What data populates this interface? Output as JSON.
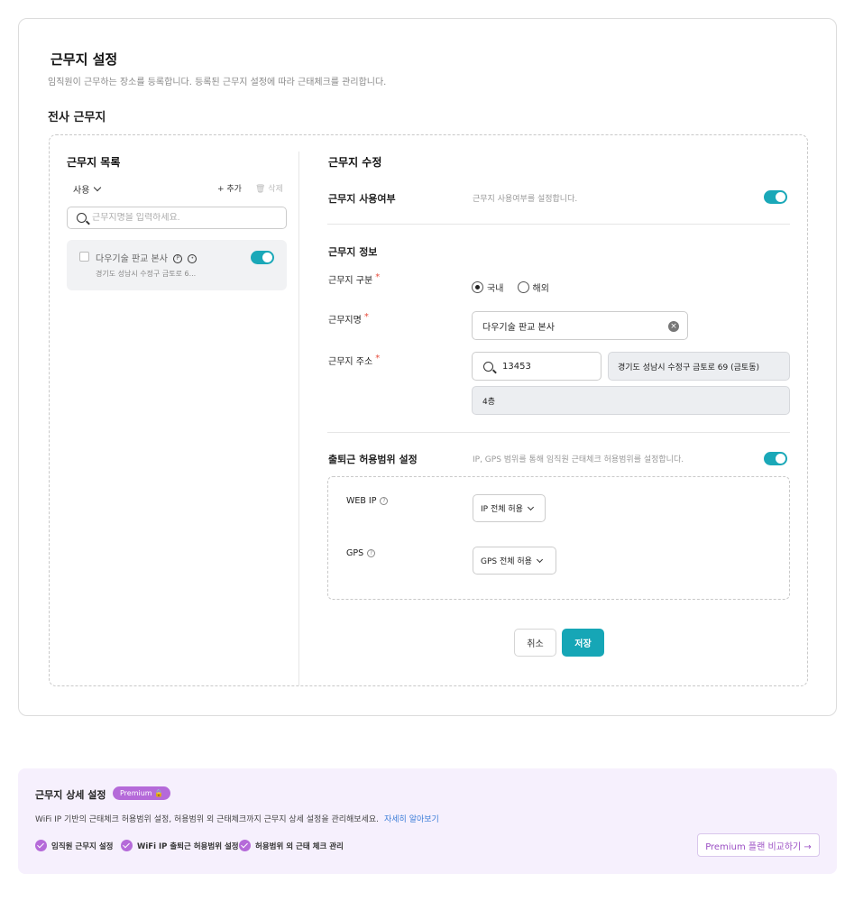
{
  "page": {
    "title": "근무지 설정",
    "subtitle": "임직원이 근무하는 장소를 등록합니다. 등록된 근무지 설정에 따라 근태체크를 관리합니다.",
    "section_title": "전사 근무지"
  },
  "list": {
    "title": "근무지 목록",
    "filter_label": "사용",
    "add_label": "+ 추가",
    "delete_label": "🗑 삭제",
    "search_placeholder": "근무지명을 입력하세요.",
    "items": [
      {
        "name": "다우기술 판교 본사",
        "address": "경기도 성남시 수정구 금토로 6...",
        "enabled": true
      }
    ]
  },
  "edit": {
    "title": "근무지 수정",
    "usage_label": "근무지 사용여부",
    "usage_hint": "근무지 사용여부를 설정합니다.",
    "usage_enabled": true,
    "info_title": "근무지 정보",
    "type_label": "근무지 구분",
    "type_options": [
      "국내",
      "해외"
    ],
    "type_selected": "국내",
    "name_label": "근무지명",
    "name_value": "다우기술 판교 본사",
    "address_label": "근무지 주소",
    "zip_value": "13453",
    "address_value": "경기도 성남시 수정구 금토로 69 (금토동)",
    "address_detail": "4층",
    "range_label": "출퇴근 허용범위 설정",
    "range_hint": "IP, GPS 범위를 통해 임직원 근태체크 허용범위를 설정합니다.",
    "range_enabled": true,
    "web_ip_label": "WEB IP",
    "web_ip_value": "IP 전체 허용",
    "gps_label": "GPS",
    "gps_value": "GPS 전체 허용",
    "cancel_label": "취소",
    "save_label": "저장"
  },
  "premium": {
    "title": "근무지 상세 설정",
    "badge": "Premium 🔒",
    "description": "WiFi IP 기반의 근태체크 허용범위 설정, 허용범위 외 근태체크까지 근무지 상세 설정을 관리해보세요.",
    "link": "자세히 알아보기",
    "features": [
      "임직원 근무지 설정",
      "WiFi IP 출퇴근 허용범위 설정",
      "허용범위 외 근태 체크 관리"
    ],
    "compare_button": "Premium 플랜 비교하기 →"
  },
  "colors": {
    "accent": "#16a6b6",
    "premium": "#b56ad9",
    "required": "#e74c3c"
  }
}
